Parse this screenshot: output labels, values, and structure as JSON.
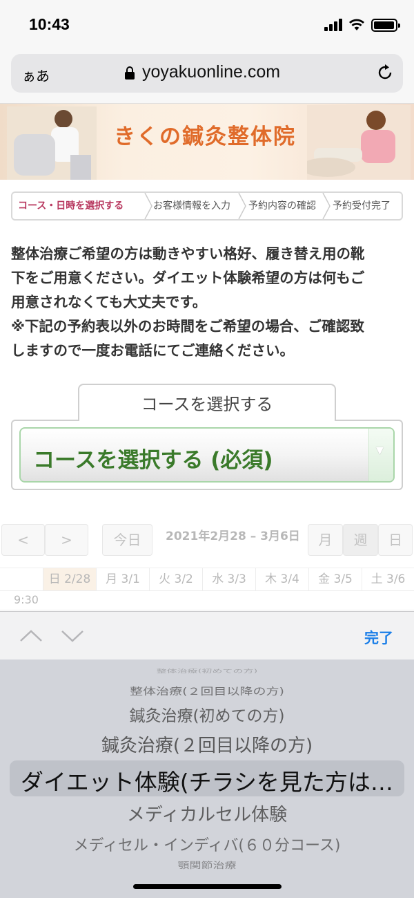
{
  "status_bar": {
    "time": "10:43"
  },
  "browser": {
    "aa": "ぁあ",
    "url": "yoyakuonline.com"
  },
  "banner": {
    "title": "きくの鍼灸整体院"
  },
  "steps": [
    {
      "label": "コース・日時を選択する",
      "active": true
    },
    {
      "label": "お客様情報を入力",
      "active": false
    },
    {
      "label": "予約内容の確認",
      "active": false
    },
    {
      "label": "予約受付完了",
      "active": false
    }
  ],
  "notice": {
    "line1": "整体治療ご希望の方は動きやすい格好、履き替え用の靴",
    "line2": "下をご用意ください。ダイエット体験希望の方は何もご",
    "line3": "用意されなくても大丈夫です。",
    "line4": "※下記の予約表以外のお時間をご希望の場合、ご確認致",
    "line5": "しますので一度お電話にてご連絡ください。"
  },
  "course": {
    "tab_label": "コースを選択する",
    "select_label": "コースを選択する (必須)"
  },
  "calendar": {
    "prev": "<",
    "next": ">",
    "today": "今日",
    "range": "2021年2月28 – 3月6日",
    "views": [
      "月",
      "週",
      "日"
    ],
    "active_view": "週",
    "days": [
      "日 2/28",
      "月 3/1",
      "火 3/2",
      "水 3/3",
      "木 3/4",
      "金 3/5",
      "土 3/6"
    ],
    "first_time": "9:30"
  },
  "picker": {
    "done": "完了",
    "options": [
      "整体治療(初めての方)",
      "整体治療(２回目以降の方)",
      "鍼灸治療(初めての方)",
      "鍼灸治療(２回目以降の方)",
      "ダイエット体験(チラシを見た方は…",
      "メディカルセル体験",
      "メディセル・インディバ(６０分コース)",
      "顎関節治療"
    ],
    "selected_index": 4
  },
  "colors": {
    "active_step": "#b8385f",
    "select_text": "#3a7a2a",
    "done_blue": "#1a7ee8",
    "banner_title": "#e06b2a"
  }
}
